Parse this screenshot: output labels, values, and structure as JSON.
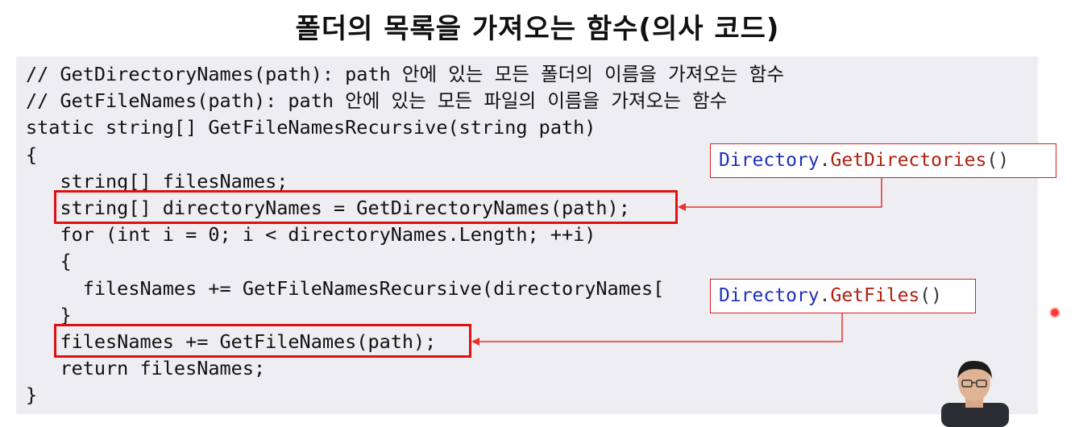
{
  "title": "폴더의 목록을 가져오는 함수(의사 코드)",
  "code_lines": [
    "// GetDirectoryNames(path): path 안에 있는 모든 폴더의 이름을 가져오는 함수",
    "// GetFileNames(path): path 안에 있는 모든 파일의 이름을 가져오는 함수",
    "static string[] GetFileNamesRecursive(string path)",
    "{",
    "   string[] filesNames;",
    "   string[] directoryNames = GetDirectoryNames(path);",
    "   for (int i = 0; i < directoryNames.Length; ++i)",
    "   {",
    "     filesNames += GetFileNamesRecursive(directoryNames[",
    "   }",
    "   filesNames += GetFileNames(path);",
    "   return filesNames;",
    "}"
  ],
  "callouts": {
    "directories": {
      "class": "Directory",
      "dot": ".",
      "method": "GetDirectories",
      "parens": "()"
    },
    "files": {
      "class": "Directory",
      "dot": ".",
      "method": "GetFiles",
      "parens": "()"
    }
  },
  "colors": {
    "highlight": "#e01010",
    "class_name": "#2030c0",
    "method_name": "#b02010",
    "panel_bg": "#eeeef2"
  }
}
